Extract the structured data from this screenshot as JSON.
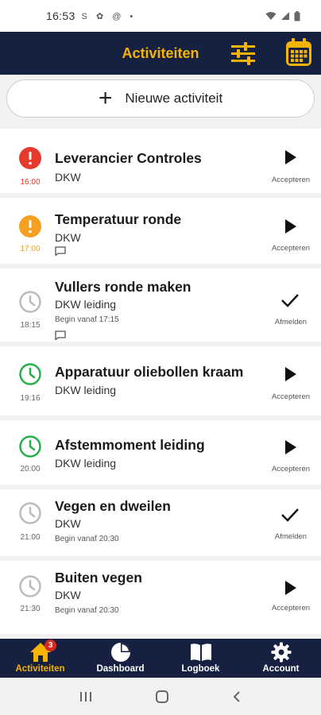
{
  "status_bar": {
    "time": "16:53",
    "system_icons": "S ✿ @ •"
  },
  "header": {
    "title": "Activiteiten",
    "accent_color": "#f5b400",
    "bg_color": "#162142"
  },
  "new_activity": {
    "label": "Nieuwe activiteit"
  },
  "activities": [
    {
      "title": "Leverancier Controles",
      "subtitle": "DKW",
      "time": "16:00",
      "status": "overdue",
      "status_color": "#e53a2c",
      "begin": "",
      "has_comment": false,
      "action": "Accepteren",
      "action_icon": "play-icon"
    },
    {
      "title": "Temperatuur ronde",
      "subtitle": "DKW",
      "time": "17:00",
      "status": "warning",
      "status_color": "#f5a020",
      "begin": "",
      "has_comment": true,
      "action": "Accepteren",
      "action_icon": "play-icon"
    },
    {
      "title": "Vullers ronde maken",
      "subtitle": "DKW leiding",
      "time": "18:15",
      "status": "scheduled",
      "status_color": "#bbbbbb",
      "begin": "Begin vanaf 17:15",
      "has_comment": true,
      "action": "Afmelden",
      "action_icon": "check-icon"
    },
    {
      "title": "Apparatuur oliebollen kraam",
      "subtitle": "DKW leiding",
      "time": "19:16",
      "status": "active",
      "status_color": "#26b04a",
      "begin": "",
      "has_comment": false,
      "action": "Accepteren",
      "action_icon": "play-icon"
    },
    {
      "title": "Afstemmoment leiding",
      "subtitle": "DKW leiding",
      "time": "20:00",
      "status": "active",
      "status_color": "#26b04a",
      "begin": "",
      "has_comment": false,
      "action": "Accepteren",
      "action_icon": "play-icon"
    },
    {
      "title": "Vegen en dweilen",
      "subtitle": "DKW",
      "time": "21:00",
      "status": "scheduled",
      "status_color": "#bbbbbb",
      "begin": "Begin vanaf 20:30",
      "has_comment": false,
      "action": "Afmelden",
      "action_icon": "check-icon"
    },
    {
      "title": "Buiten vegen",
      "subtitle": "DKW",
      "time": "21:30",
      "status": "scheduled",
      "status_color": "#bbbbbb",
      "begin": "Begin vanaf 20:30",
      "has_comment": false,
      "action": "Accepteren",
      "action_icon": "play-icon"
    }
  ],
  "tabs": [
    {
      "label": "Activiteiten",
      "icon": "home-icon",
      "active": true,
      "badge": "3"
    },
    {
      "label": "Dashboard",
      "icon": "pie-chart-icon",
      "active": false
    },
    {
      "label": "Logboek",
      "icon": "book-icon",
      "active": false
    },
    {
      "label": "Account",
      "icon": "gear-icon",
      "active": false
    }
  ]
}
